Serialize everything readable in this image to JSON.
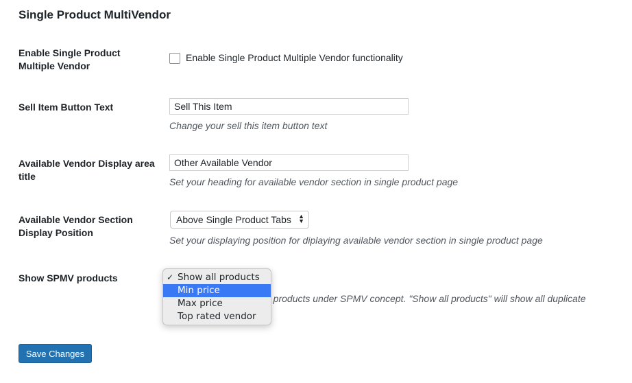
{
  "page": {
    "title": "Single Product MultiVendor"
  },
  "fields": {
    "enable_spmv": {
      "label": "Enable Single Product Multiple Vendor",
      "checkbox_label": "Enable Single Product Multiple Vendor functionality",
      "checked": false
    },
    "sell_item_button_text": {
      "label": "Sell Item Button Text",
      "value": "Sell This Item",
      "description": "Change your sell this item button text"
    },
    "vendor_display_title": {
      "label": "Available Vendor Display area title",
      "value": "Other Available Vendor",
      "description": "Set your heading for available vendor section in single product page"
    },
    "vendor_section_position": {
      "label": "Available Vendor Section Display Position",
      "selected": "Above Single Product Tabs",
      "description": "Set your displaying position for diplaying available vendor section in single product page"
    },
    "show_spmv_products": {
      "label": "Show SPMV products",
      "description_visible": "n products under SPMV concept. \"Show all products\" will show all duplicate",
      "options": [
        {
          "label": "Show all products",
          "checked": true,
          "highlighted": false
        },
        {
          "label": "Min price",
          "checked": false,
          "highlighted": true
        },
        {
          "label": "Max price",
          "checked": false,
          "highlighted": false
        },
        {
          "label": "Top rated vendor",
          "checked": false,
          "highlighted": false
        }
      ],
      "check_glyph": "✓"
    }
  },
  "actions": {
    "save_label": "Save Changes"
  },
  "colors": {
    "primary": "#2271b1",
    "highlight": "#3a79f5"
  }
}
